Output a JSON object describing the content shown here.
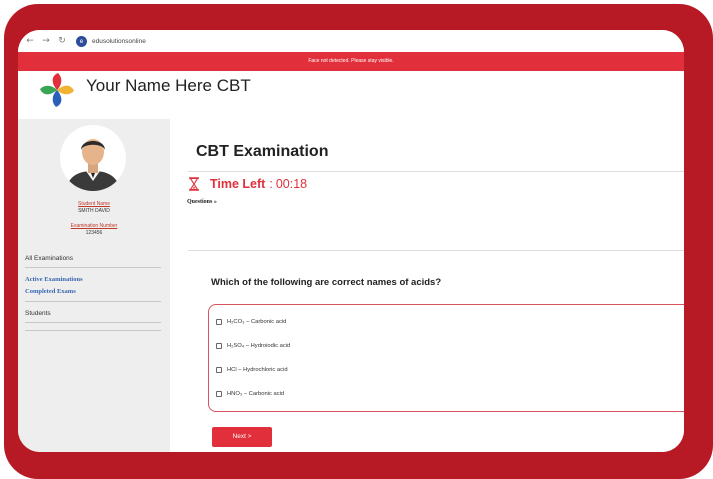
{
  "browser": {
    "back_icon": "←",
    "forward_icon": "→",
    "reload_icon": "↻",
    "url": "edusolutionsonline"
  },
  "notice": "Face not detected. Please stay visible.",
  "header": {
    "brand": "Your Name Here CBT"
  },
  "sidebar": {
    "student_name_label": "Student Name",
    "student_name_value": "SMITH DAVID",
    "exam_number_label": "Examination Number",
    "exam_number_value": "123456",
    "all_examinations": "All Examinations",
    "active_examinations": "Active Examinations",
    "completed_exams": "Completed Exams",
    "students": "Students"
  },
  "main": {
    "title": "CBT Examination",
    "time_left_label": "Time Left",
    "time_sep": ":",
    "time_value": "00:18",
    "questions_link": "Questions »",
    "question": "Which of the following are correct names of acids?",
    "options": [
      "H₂CO₃ – Carbonic acid",
      "H₂SO₄ – Hydroiodic acid",
      "HCl – Hydrochloric acid",
      "HNO₃ – Carbonic acid"
    ],
    "next_label": "Next >"
  },
  "colors": {
    "frame": "#b71a25",
    "accent_red": "#e1303b",
    "link_blue": "#3a66b0"
  },
  "icons": {
    "timer": "hourglass-icon",
    "logo": "pinwheel-logo",
    "avatar": "user-avatar"
  }
}
